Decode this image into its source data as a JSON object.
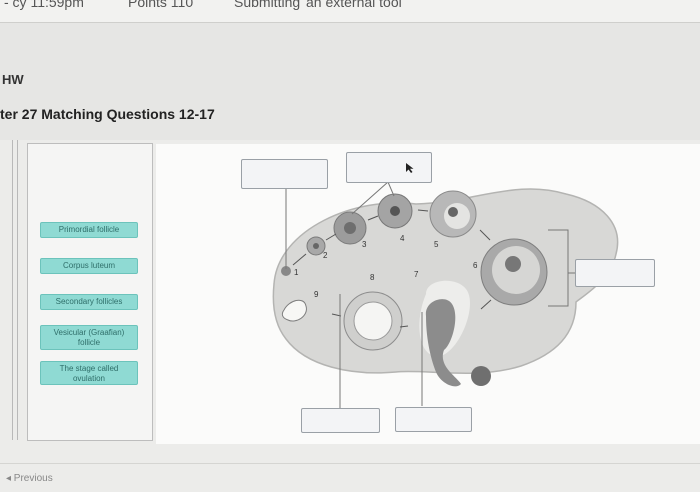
{
  "header": {
    "left_fragment": "- cy 11:59pm",
    "points_fragment": "Points 110",
    "status_fragment": "Submitting",
    "tool_fragment": "an external tool"
  },
  "assignment": {
    "hw_label": "HW",
    "title": "ter 27 Matching Questions 12-17"
  },
  "word_bank": [
    {
      "label": "Primordial follicle"
    },
    {
      "label": "Corpus luteum"
    },
    {
      "label": "Secondary follicles"
    },
    {
      "label": "Vesicular (Graafian) follicle"
    },
    {
      "label": "The stage called ovulation"
    }
  ],
  "diagram_numbers": [
    "1",
    "2",
    "3",
    "4",
    "5",
    "6",
    "7",
    "8",
    "9"
  ],
  "nav": {
    "previous_label": "◂ Previous"
  }
}
